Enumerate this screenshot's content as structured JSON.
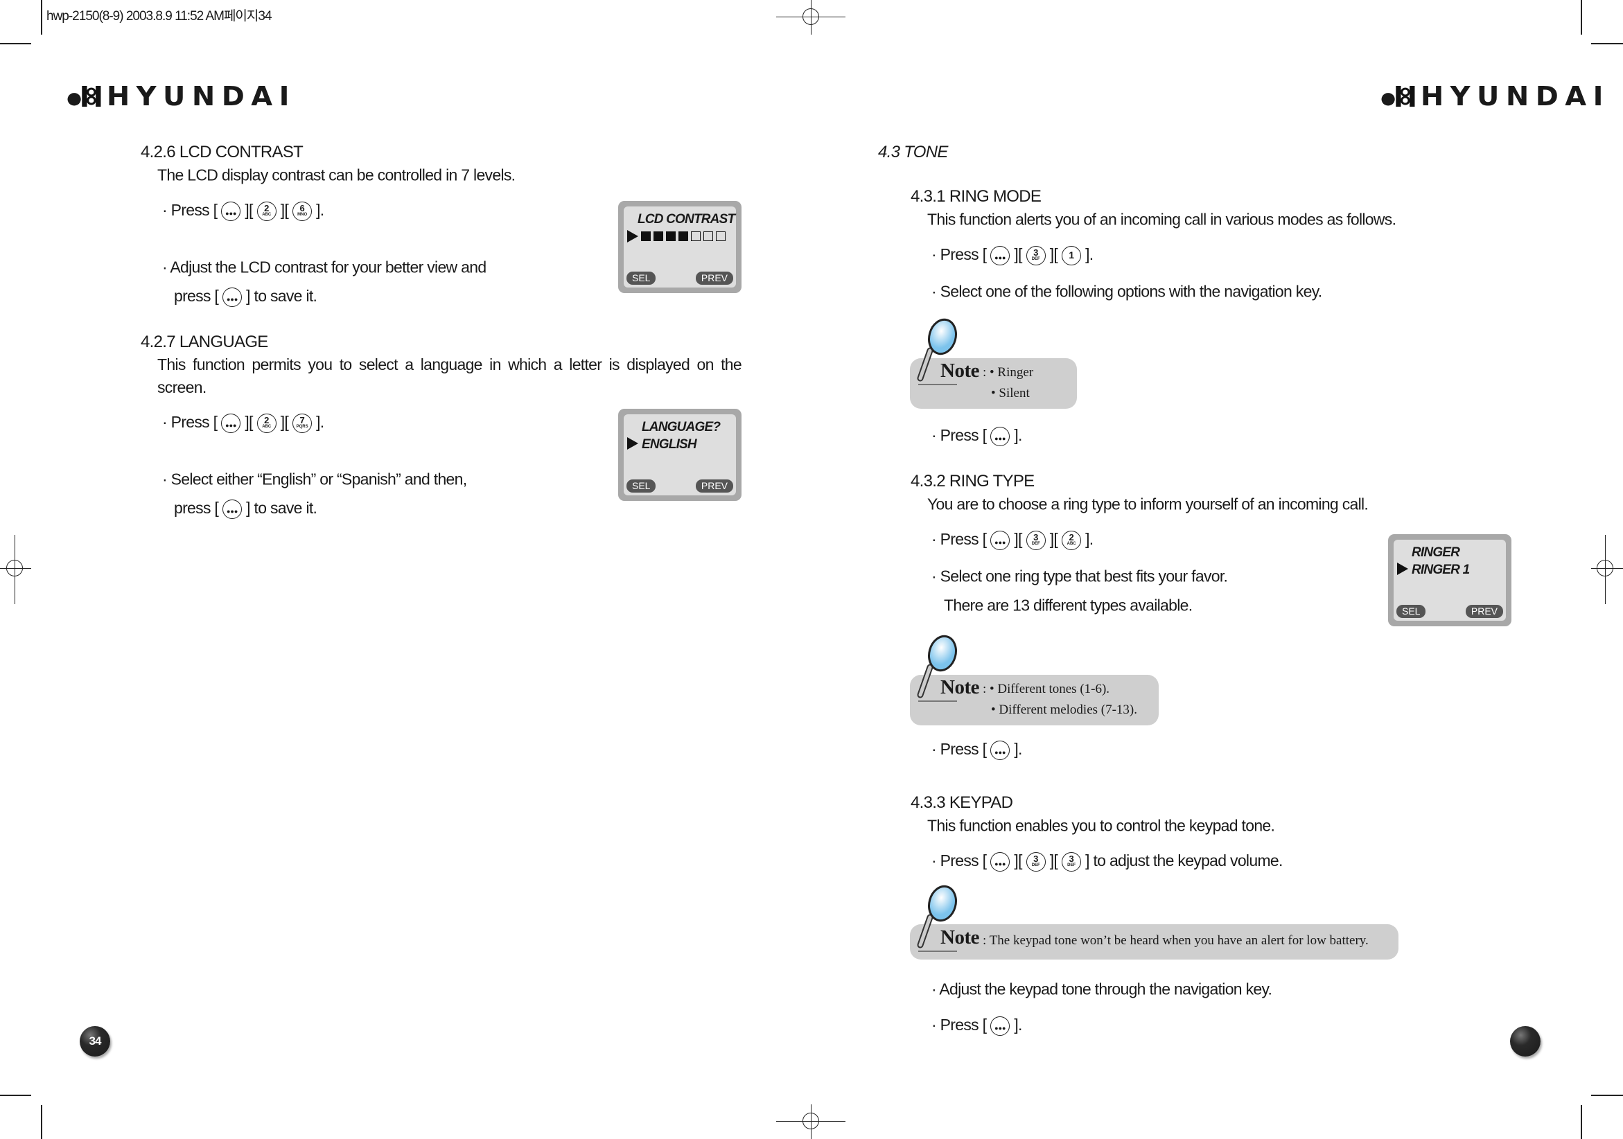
{
  "print_header": "hwp-2150(8-9)  2003.8.9 11:52 AM페이지34",
  "brand": "HYUNDAI",
  "left_page": {
    "page_number": "34",
    "lcd_contrast": {
      "heading": "4.2.6 LCD CONTRAST",
      "intro": "The LCD display contrast can be controlled in 7 levels.",
      "step1": {
        "prefix": "· Press [",
        "keys": [
          {
            "type": "menu"
          },
          {
            "num": "2",
            "letters": "ABC"
          },
          {
            "num": "6",
            "letters": "MNO"
          }
        ],
        "suffix": "]."
      },
      "step2_line1": "· Adjust the LCD contrast for your better view and",
      "step2_line2": {
        "prefix": "press [",
        "keys": [
          {
            "type": "menu"
          }
        ],
        "suffix": "] to save it."
      },
      "screen": {
        "title": "LCD CONTRAST",
        "level": 4,
        "levels": 7,
        "left_softkey": "SEL",
        "right_softkey": "PREV"
      }
    },
    "language": {
      "heading": "4.2.7 LANGUAGE",
      "intro": "This function permits you to select a language in which a letter is displayed on the screen.",
      "step1": {
        "prefix": "· Press [",
        "keys": [
          {
            "type": "menu"
          },
          {
            "num": "2",
            "letters": "ABC"
          },
          {
            "num": "7",
            "letters": "PQRS"
          }
        ],
        "suffix": "]."
      },
      "step2_line1": "· Select either “English” or “Spanish” and then,",
      "step2_line2": {
        "prefix": "press [",
        "keys": [
          {
            "type": "menu"
          }
        ],
        "suffix": "] to save it."
      },
      "screen": {
        "title": "LANGUAGE?",
        "selected": "ENGLISH",
        "left_softkey": "SEL",
        "right_softkey": "PREV"
      }
    }
  },
  "right_page": {
    "heading": "4.3 TONE",
    "ring_mode": {
      "heading": "4.3.1 RING MODE",
      "intro": "This function alerts you of an incoming call in various modes as follows.",
      "step1": {
        "prefix": "· Press [",
        "keys": [
          {
            "type": "menu"
          },
          {
            "num": "3",
            "letters": "DEF"
          },
          {
            "num": "1",
            "letters": ""
          }
        ],
        "suffix": "]."
      },
      "step2": "· Select one of the following options with the navigation key.",
      "note": {
        "label": "Note",
        "sep": ":",
        "items": [
          "• Ringer",
          "• Silent"
        ]
      },
      "step3": {
        "prefix": "· Press [",
        "keys": [
          {
            "type": "menu"
          }
        ],
        "suffix": "]."
      }
    },
    "ring_type": {
      "heading": "4.3.2 RING TYPE",
      "intro": "You are to choose a ring type to inform yourself of an incoming call.",
      "step1": {
        "prefix": "· Press [",
        "keys": [
          {
            "type": "menu"
          },
          {
            "num": "3",
            "letters": "DEF"
          },
          {
            "num": "2",
            "letters": "ABC"
          }
        ],
        "suffix": "]."
      },
      "step2_line1": "· Select one ring type that best fits your favor.",
      "step2_line2": "There are 13 different types available.",
      "screen": {
        "title": "RINGER",
        "selected": "RINGER 1",
        "left_softkey": "SEL",
        "right_softkey": "PREV"
      },
      "note": {
        "label": "Note",
        "sep": ":",
        "items": [
          "• Different tones (1-6).",
          "• Different melodies (7-13)."
        ]
      },
      "step3": {
        "prefix": "· Press [",
        "keys": [
          {
            "type": "menu"
          }
        ],
        "suffix": "]."
      }
    },
    "keypad": {
      "heading": "4.3.3 KEYPAD",
      "intro": "This function enables you to control the keypad tone.",
      "step1": {
        "prefix": "· Press [",
        "keys": [
          {
            "type": "menu"
          },
          {
            "num": "3",
            "letters": "DEF"
          },
          {
            "num": "3",
            "letters": "DEF"
          }
        ],
        "suffix": "] to adjust the keypad volume."
      },
      "note": {
        "label": "Note",
        "sep": ":",
        "text": "The keypad tone won’t be heard when you have an alert for low battery."
      },
      "step2": "· Adjust the keypad tone through the navigation key.",
      "step3": {
        "prefix": "· Press [",
        "keys": [
          {
            "type": "menu"
          }
        ],
        "suffix": "]."
      }
    }
  }
}
